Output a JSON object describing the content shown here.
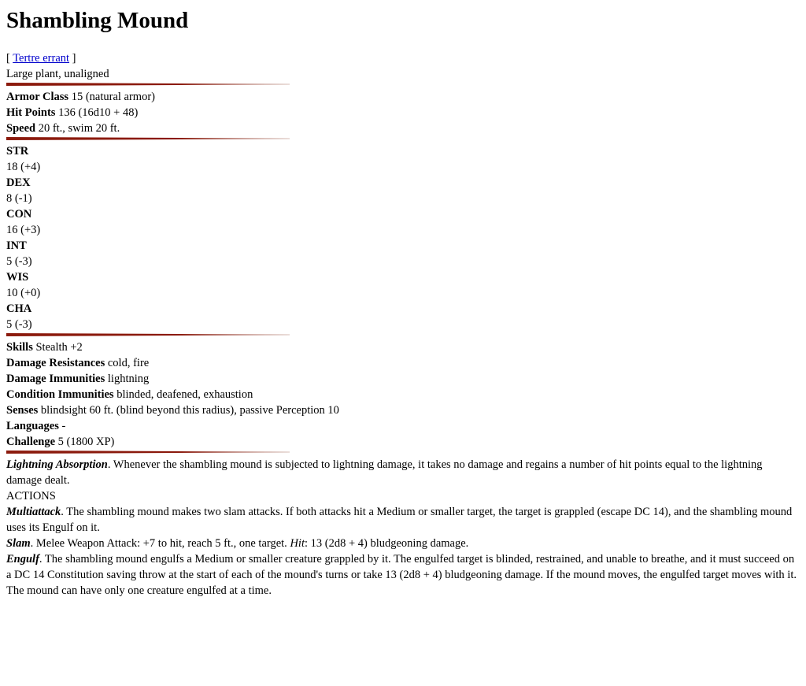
{
  "title": "Shambling Mound",
  "alt_name": {
    "open": "[ ",
    "link": "Tertre errant",
    "close": " ]"
  },
  "type_line": "Large plant, unaligned",
  "defense": {
    "ac_label": "Armor Class",
    "ac_value": " 15 (natural armor)",
    "hp_label": "Hit Points",
    "hp_value": " 136 (16d10 + 48)",
    "speed_label": "Speed",
    "speed_value": " 20 ft., swim 20 ft."
  },
  "abilities": [
    {
      "name": "STR",
      "score": "18 (+4)"
    },
    {
      "name": "DEX",
      "score": "8 (-1)"
    },
    {
      "name": "CON",
      "score": "16 (+3)"
    },
    {
      "name": "INT",
      "score": "5 (-3)"
    },
    {
      "name": "WIS",
      "score": "10 (+0)"
    },
    {
      "name": "CHA",
      "score": "5 (-3)"
    }
  ],
  "properties": {
    "skills_label": "Skills",
    "skills_value": " Stealth +2",
    "dres_label": "Damage Resistances",
    "dres_value": " cold, fire",
    "dimm_label": "Damage Immunities",
    "dimm_value": " lightning",
    "cimm_label": "Condition Immunities",
    "cimm_value": " blinded, deafened, exhaustion",
    "senses_label": "Senses",
    "senses_value": " blindsight 60 ft. (blind beyond this radius), passive Perception 10",
    "lang_label": "Languages",
    "lang_value": " -",
    "chal_label": "Challenge",
    "chal_value": " 5 (1800 XP)"
  },
  "traits": {
    "lightning_name": "Lightning Absorption",
    "lightning_text": ". Whenever the shambling mound is subjected to lightning damage, it takes no damage and regains a number of hit points equal to the lightning damage dealt."
  },
  "actions_heading": "ACTIONS",
  "actions": {
    "multi_name": "Multiattack",
    "multi_text": ". The shambling mound makes two slam attacks. If both attacks hit a Medium or smaller target, the target is grappled (escape DC 14), and the shambling mound uses its Engulf on it.",
    "slam_name": "Slam",
    "slam_text1": ". Melee Weapon Attack: +7 to hit, reach 5 ft., one target. ",
    "slam_hit": "Hit",
    "slam_text2": ": 13 (2d8 + 4) bludgeoning damage.",
    "engulf_name": "Engulf",
    "engulf_text": ". The shambling mound engulfs a Medium or smaller creature grappled by it. The engulfed target is blinded, restrained, and unable to breathe, and it must succeed on a DC 14 Constitution saving throw at the start of each of the mound's turns or take 13 (2d8 + 4) bludgeoning damage. If the mound moves, the engulfed target moves with it. The mound can have only one creature engulfed at a time."
  }
}
